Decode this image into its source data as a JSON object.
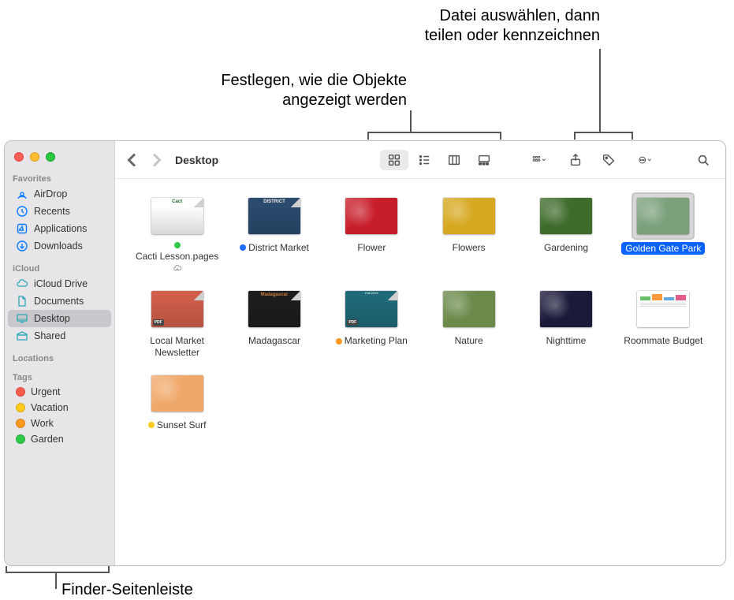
{
  "callouts": {
    "top_right_line1": "Datei auswählen, dann",
    "top_right_line2": "teilen oder kennzeichnen",
    "mid_line1": "Festlegen, wie die Objekte",
    "mid_line2": "angezeigt werden",
    "bottom": "Finder-Seitenleiste"
  },
  "toolbar": {
    "title": "Desktop"
  },
  "sidebar": {
    "favorites_header": "Favorites",
    "favorites": [
      {
        "label": "AirDrop"
      },
      {
        "label": "Recents"
      },
      {
        "label": "Applications"
      },
      {
        "label": "Downloads"
      }
    ],
    "icloud_header": "iCloud",
    "icloud": [
      {
        "label": "iCloud Drive"
      },
      {
        "label": "Documents"
      },
      {
        "label": "Desktop",
        "selected": true
      },
      {
        "label": "Shared"
      }
    ],
    "locations_header": "Locations",
    "tags_header": "Tags",
    "tags": [
      {
        "label": "Urgent",
        "color": "#ff5b4d"
      },
      {
        "label": "Vacation",
        "color": "#ffcc1f"
      },
      {
        "label": "Work",
        "color": "#ff9a1f"
      },
      {
        "label": "Garden",
        "color": "#2fc94a"
      }
    ]
  },
  "files": [
    {
      "label": "Cacti Lesson.pages",
      "tag": "#2fc94a",
      "cloud": true,
      "thumb": {
        "type": "doc",
        "bg": "#ffffff",
        "accent": "#1d6c2e",
        "text": "Cact"
      }
    },
    {
      "label": "District Market",
      "tag": "#1f6bff",
      "thumb": {
        "type": "doc",
        "bg": "#2a4b6e",
        "accent": "#f2ede0",
        "text": "DISTRICT"
      }
    },
    {
      "label": "Flower",
      "thumb": {
        "type": "photo",
        "bg": "#c81e2a"
      }
    },
    {
      "label": "Flowers",
      "thumb": {
        "type": "photo",
        "bg": "#d6a81f"
      }
    },
    {
      "label": "Gardening",
      "thumb": {
        "type": "photo",
        "bg": "#3d6b2a"
      }
    },
    {
      "label": "Golden Gate Park",
      "selected": true,
      "thumb": {
        "type": "photo",
        "bg": "#7aa07a"
      }
    },
    {
      "label": "Local Market Newsletter",
      "thumb": {
        "type": "doc",
        "bg": "#d4604b",
        "accent": "#7b2d1c",
        "badge": "PDF"
      }
    },
    {
      "label": "Madagascar",
      "thumb": {
        "type": "doc",
        "bg": "#1d1d1d",
        "accent": "#c97d3d",
        "text": "Madagascar"
      }
    },
    {
      "label": "Marketing Plan",
      "tag": "#ff9a1f",
      "thumb": {
        "type": "doc",
        "bg": "#1f6b7a",
        "accent": "#ffffff",
        "badge": "PDF",
        "sub": "Fall 2019"
      }
    },
    {
      "label": "Nature",
      "thumb": {
        "type": "photo",
        "bg": "#6b8a4a"
      }
    },
    {
      "label": "Nighttime",
      "thumb": {
        "type": "photo",
        "bg": "#1a1a3a"
      }
    },
    {
      "label": "Roommate Budget",
      "thumb": {
        "type": "sheet",
        "bg": "#ffffff"
      }
    },
    {
      "label": "Sunset Surf",
      "tag": "#ffcc1f",
      "thumb": {
        "type": "photo",
        "bg": "#f0a86a"
      }
    }
  ]
}
